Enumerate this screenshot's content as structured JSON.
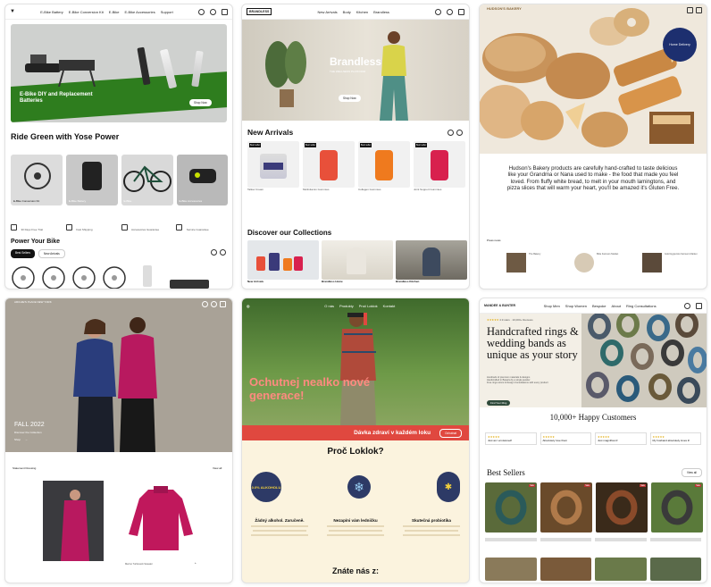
{
  "c1": {
    "nav": [
      "E-Bike Battery",
      "E-Bike Conversion Kit",
      "E-Bike",
      "E-Bike Accessories",
      "Support"
    ],
    "hero_title": "E-Bike DIY and Replacement Batteries",
    "hero_btn": "Shop Now",
    "section_title": "Ride Green with Yose Power",
    "cats": [
      "E-Bike Conversion Kit",
      "E-Bike Battery",
      "E-Bike",
      "E-Bike Accessories"
    ],
    "features": [
      "30 Days Free Trial",
      "Fast Shipping",
      "Accessories Guarantee",
      "Service Guarantee"
    ],
    "power_title": "Power Your Bike",
    "tabs": [
      "Best Sellers",
      "New Arrivals"
    ]
  },
  "c2": {
    "logo": "BRANDLESS",
    "nav": [
      "New Arrivals",
      "Body",
      "Kitchen",
      "Brandless"
    ],
    "hero_title": "Brandless",
    "hero_sub": "THE WELLNESS PLATFORM",
    "hero_btn": "Shop Now",
    "arrivals_title": "New Arrivals",
    "badge": "Best seller",
    "products": [
      "Tallow Cream",
      "Multivitamin Gummies",
      "Collagen Gummies",
      "Joint Support Gummies"
    ],
    "collections_title": "Discover our Collections",
    "collections": [
      "New Arrivals",
      "Brandless Home",
      "Brandless Kitchen"
    ]
  },
  "c3": {
    "logo": "HUDSON'S BAKERY",
    "badge": "Home Delivery",
    "text": "Hudson's Bakery products are carefully hand-crafted to taste delicious like your Grandma or Nana used to make - the food that made you feel loved. From fluffy white bread, to melt in your mouth lamingtons, and pizza slices that will warm your heart, you'll be amazed it's Gluten Free.",
    "press_label": "Press news",
    "press": [
      "The Bakery",
      "Bitte Farmers Market",
      "Gold Hygienics Farmers Market"
    ]
  },
  "c4": {
    "logo": "ARCHIE'S PLACE NEW YORK",
    "season": "FALL 2022",
    "sub": "Discover the Collection",
    "shop": "Shop",
    "section": "Statement Dressing",
    "view_all": "View all",
    "product": "Merino Turtleneck Sweater"
  },
  "c5": {
    "nav": [
      "O nás",
      "Produkty",
      "Proč Loklok",
      "Kontakt"
    ],
    "hero_title": "Ochutnej nealko nové generace!",
    "banner": "Dávka zdraví v každém loku",
    "banner_btn": "Ochutnat",
    "section_title": "Proč Loklok?",
    "badge_text": "0.0% ALKOHOLU",
    "features": [
      "Žádný alkohol. Zaručeně.",
      "Nezapíni vám ledničku",
      "Skutečná probiotika"
    ],
    "footer_title": "Znáte nás z:"
  },
  "c6": {
    "logo": "MANDEE & BUNTER",
    "nav": [
      "Shop Men",
      "Shop Women",
      "Bespoke",
      "About",
      "Ring Consultations"
    ],
    "rating": "4.9 stars · 10,000+ Reviews",
    "hero_title": "Handcrafted rings & wedding bands as unique as your story",
    "bullets": [
      "Hundreds of premium materials & designs",
      "Handcrafted in Bavaria by a single jeweler",
      "Free rings sizers & Design Consultations with every product"
    ],
    "cta": "Find Your Ring",
    "customers_title": "10,000+ Happy Customers",
    "reviews": [
      "Just as I envisioned!",
      "Absolutely love them",
      "Just magnificent!",
      "My husband absolutely loves it!"
    ],
    "bestsellers_title": "Best Sellers",
    "view_all": "View all",
    "sale": "Sale"
  },
  "colors": {
    "green_accent": "#3f9d2f",
    "loklok_red": "#e0483f",
    "loklok_bg": "#fbf3de",
    "bakery_badge": "#1d2f6f",
    "magenta": "#b8195f",
    "navy": "#2d3a66"
  }
}
